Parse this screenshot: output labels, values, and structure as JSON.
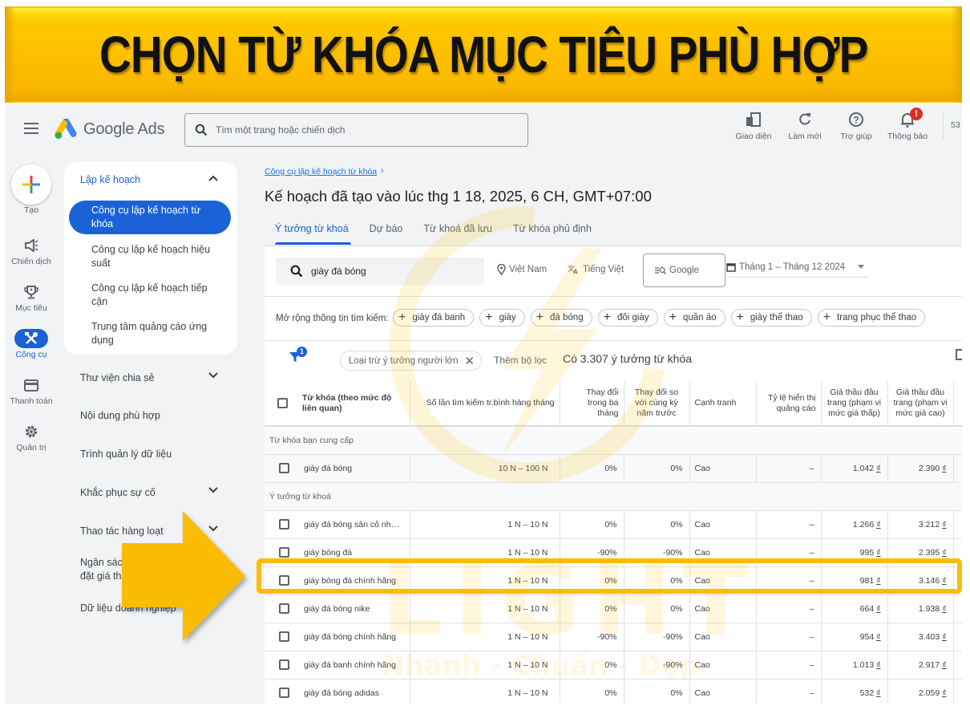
{
  "banner": {
    "title": "CHỌN TỪ KHÓA MỤC TIÊU PHÙ HỢP"
  },
  "header": {
    "app_name": "Google Ads",
    "search_placeholder": "Tìm một trang hoặc chiến dịch",
    "actions": [
      {
        "icon": "appearance-icon",
        "label": "Giao diện"
      },
      {
        "icon": "refresh-icon",
        "label": "Làm mới"
      },
      {
        "icon": "help-icon",
        "label": "Trợ giúp"
      },
      {
        "icon": "bell-icon",
        "label": "Thông báo",
        "badge": "!"
      }
    ],
    "account_id_partial": "53"
  },
  "rail": {
    "create_label": "Tạo",
    "items": [
      {
        "icon": "megaphone-icon",
        "label": "Chiến dịch"
      },
      {
        "icon": "trophy-icon",
        "label": "Mục tiêu"
      },
      {
        "icon": "tools-icon",
        "label": "Công cụ",
        "active": true
      },
      {
        "icon": "credit-card-icon",
        "label": "Thanh toán"
      },
      {
        "icon": "gear-icon",
        "label": "Quản trị"
      }
    ]
  },
  "nav": {
    "section_title": "Lập kế hoạch",
    "sub_items": [
      {
        "label": "Công cụ lập kế hoạch từ khóa",
        "active": true
      },
      {
        "label": "Công cụ lập kế hoạch hiệu suất"
      },
      {
        "label": "Công cụ lập kế hoạch tiếp cận"
      },
      {
        "label": "Trung tâm quảng cáo ứng dụng"
      }
    ],
    "items": [
      {
        "label": "Thư viện chia sẻ",
        "expandable": true
      },
      {
        "label": "Nội dung phù hợp"
      },
      {
        "label": "Trình quản lý dữ liệu"
      },
      {
        "label": "Khắc phục sự cố",
        "expandable": true
      },
      {
        "label": "Thao tác hàng loạt",
        "expandable": true
      },
      {
        "label_line1": "Ngân sách và",
        "label_line2": "đặt giá thầu",
        "visible_line1": "Ngân sác",
        "visible_line2": "đặt giá th"
      },
      {
        "label": "Dữ liệu doanh nghiệp"
      }
    ]
  },
  "main": {
    "breadcrumb": "Công cụ lập kế hoạch từ khóa",
    "title": "Kế hoạch đã tạo vào lúc thg 1 18, 2025, 6 CH, GMT+07:00",
    "tabs": [
      {
        "label": "Ý tưởng từ khoá",
        "active": true
      },
      {
        "label": "Dự báo"
      },
      {
        "label": "Từ khoá đã lưu"
      },
      {
        "label": "Từ khóa phủ định"
      }
    ],
    "keyword_input_value": "giày đá bóng",
    "location": "Việt Nam",
    "language": "Tiếng Việt",
    "network": "Google",
    "date_range": "Tháng 1 – Tháng 12 2024",
    "expand_label": "Mở rộng thông tin tìm kiếm:",
    "expand_chips": [
      "giày đá banh",
      "giày",
      "đá bóng",
      "đôi giày",
      "quần áo",
      "giày thể thao",
      "trang phục thể thao"
    ],
    "filter_count": "1",
    "active_filter": "Loại trừ ý tưởng người lớn",
    "add_filter": "Thêm bộ lọc",
    "idea_count": "Có 3.307 ý tưởng từ khóa"
  },
  "table": {
    "columns": [
      "Từ khóa (theo mức độ liên quan)",
      "Số lần tìm kiếm tr.bình hàng tháng",
      "Thay đổi trong ba tháng",
      "Thay đổi so với cùng kỳ năm trước",
      "Cạnh tranh",
      "Tỷ lệ hiển thị quảng cáo",
      "Giá thầu đầu trang (phạm vi mức giá thấp)",
      "Giá thầu đầu trang (phạm vi mức giá cao)"
    ],
    "group_provided": "Từ khóa bạn cung cấp",
    "provided_rows": [
      {
        "keyword": "giày đá bóng",
        "volume": "10 N – 100 N",
        "three_month": "0%",
        "yoy": "0%",
        "competition": "Cao",
        "impr_share": "–",
        "bid_low": "1.042",
        "bid_high": "2.390"
      }
    ],
    "group_ideas": "Ý tưởng từ khoá",
    "idea_rows": [
      {
        "keyword": "giày đá bóng sân cỏ nhân...",
        "volume": "1 N – 10 N",
        "three_month": "0%",
        "yoy": "0%",
        "competition": "Cao",
        "impr_share": "–",
        "bid_low": "1.266",
        "bid_high": "3.212"
      },
      {
        "keyword": "giày bóng đá",
        "volume": "1 N – 10 N",
        "three_month": "-90%",
        "yoy": "-90%",
        "competition": "Cao",
        "impr_share": "–",
        "bid_low": "995",
        "bid_high": "2.395"
      },
      {
        "keyword": "giày bóng đá chính hãng",
        "volume": "1 N – 10 N",
        "three_month": "0%",
        "yoy": "0%",
        "competition": "Cao",
        "impr_share": "–",
        "bid_low": "981",
        "bid_high": "3.146",
        "highlighted": true
      },
      {
        "keyword": "giày đá bóng nike",
        "volume": "1 N – 10 N",
        "three_month": "0%",
        "yoy": "0%",
        "competition": "Cao",
        "impr_share": "–",
        "bid_low": "664",
        "bid_high": "1.938"
      },
      {
        "keyword": "giày đá bóng chính hãng",
        "volume": "1 N – 10 N",
        "three_month": "-90%",
        "yoy": "-90%",
        "competition": "Cao",
        "impr_share": "–",
        "bid_low": "954",
        "bid_high": "3.403"
      },
      {
        "keyword": "giày đá banh chính hãng",
        "volume": "1 N – 10 N",
        "three_month": "0%",
        "yoy": "-90%",
        "competition": "Cao",
        "impr_share": "–",
        "bid_low": "1.013",
        "bid_high": "2.917"
      },
      {
        "keyword": "giày đá bóng adidas",
        "volume": "1 N – 10 N",
        "three_month": "0%",
        "yoy": "0%",
        "competition": "Cao",
        "impr_share": "–",
        "bid_low": "532",
        "bid_high": "2.059"
      }
    ],
    "currency": "₫"
  },
  "watermark": {
    "brand": "LIGHT",
    "slogan": "Nhanh - Chuẩn - Đẹp"
  },
  "colors": {
    "accent": "#1a62d6",
    "highlight": "#fbbc05",
    "banner": "#ffc800"
  }
}
